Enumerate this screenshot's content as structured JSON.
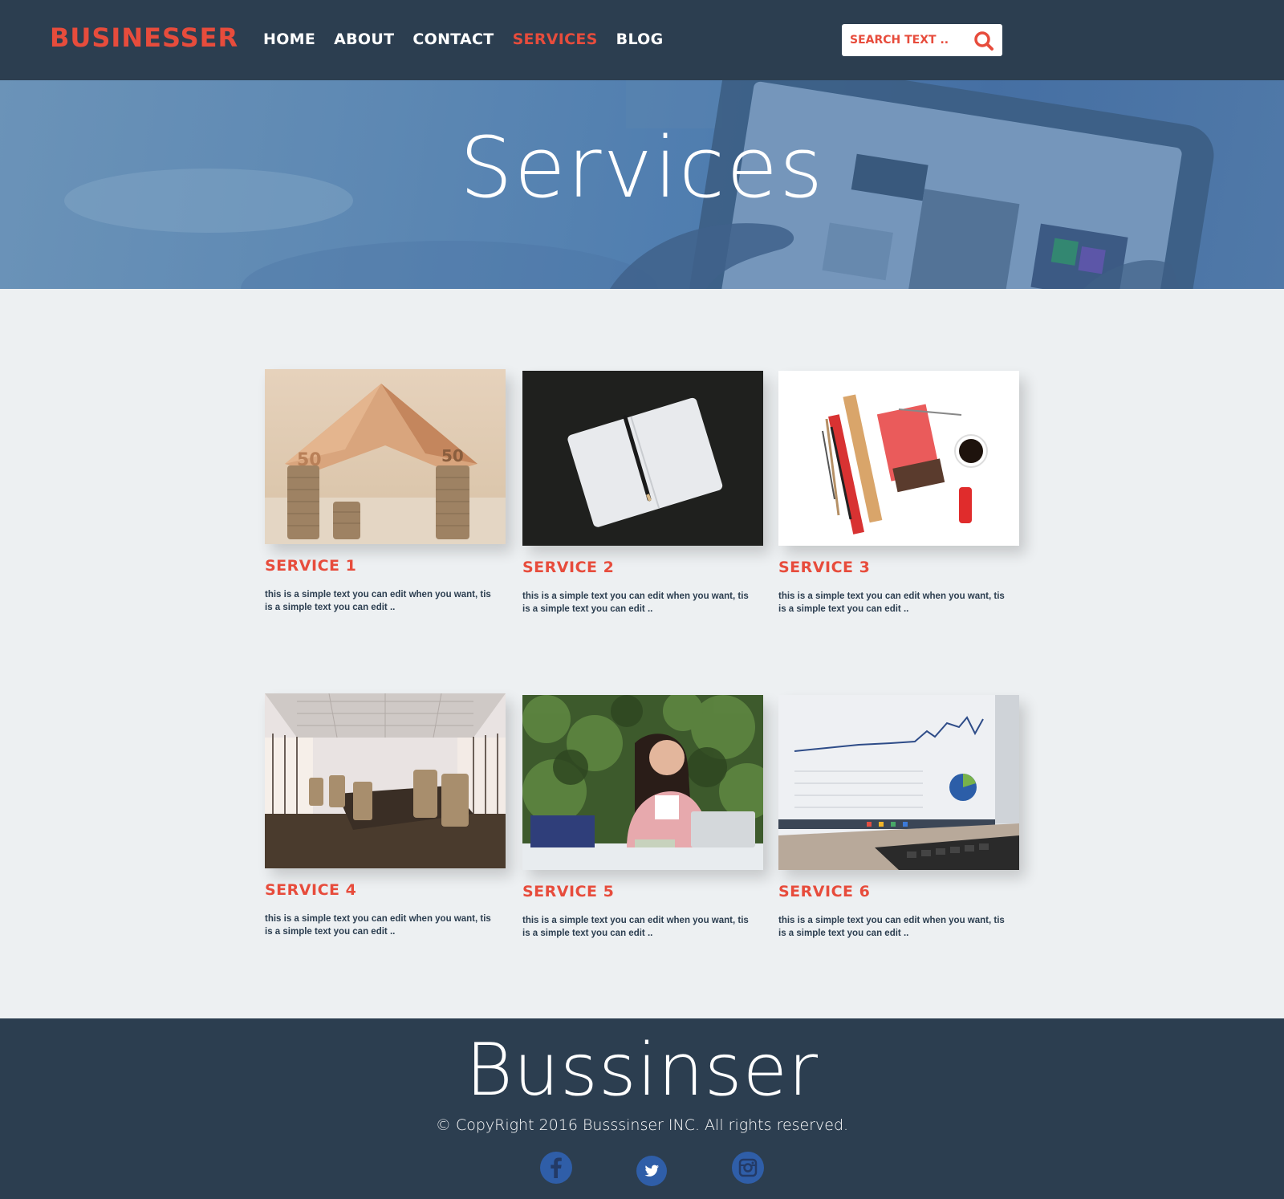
{
  "header": {
    "logo": "BUSINESSER",
    "nav": [
      {
        "label": "HOME",
        "active": false
      },
      {
        "label": "ABOUT",
        "active": false
      },
      {
        "label": "CONTACT",
        "active": false
      },
      {
        "label": "SERVICES",
        "active": true
      },
      {
        "label": "BLOG",
        "active": false
      }
    ],
    "search": {
      "placeholder": "SEARCH TEXT ..",
      "icon": "search-icon"
    }
  },
  "hero": {
    "title": "Services"
  },
  "services": [
    {
      "title": "SERVICE 1",
      "text": "this is a simple text you can edit when you want, tis  is a simple text you can edit ..",
      "image": "money-house"
    },
    {
      "title": "SERVICE 2",
      "text": "this is a simple text you can edit when you want, tis  is a simple text you can edit ..",
      "image": "notebook-pencil"
    },
    {
      "title": "SERVICE 3",
      "text": "this is a simple text you can edit when you want, tis  is a simple text you can edit ..",
      "image": "desk-supplies"
    },
    {
      "title": "SERVICE 4",
      "text": "this is a simple text you can edit when you want, tis  is a simple text you can edit ..",
      "image": "conference-room"
    },
    {
      "title": "SERVICE 5",
      "text": "this is a simple text you can edit when you want, tis  is a simple text you can edit ..",
      "image": "woman-on-phone"
    },
    {
      "title": "SERVICE 6",
      "text": "this is a simple text you can edit when you want, tis  is a simple text you can edit ..",
      "image": "laptop-chart"
    }
  ],
  "footer": {
    "brand": "Bussinser",
    "copyright": "© CopyRight 2016 Busssinser INC. All rights reserved.",
    "social": [
      "facebook-icon",
      "twitter-icon",
      "instagram-icon"
    ]
  },
  "colors": {
    "navy": "#2c3e50",
    "accent": "#e74c3c",
    "background": "#edf0f2",
    "social": "#2f5ea8"
  }
}
